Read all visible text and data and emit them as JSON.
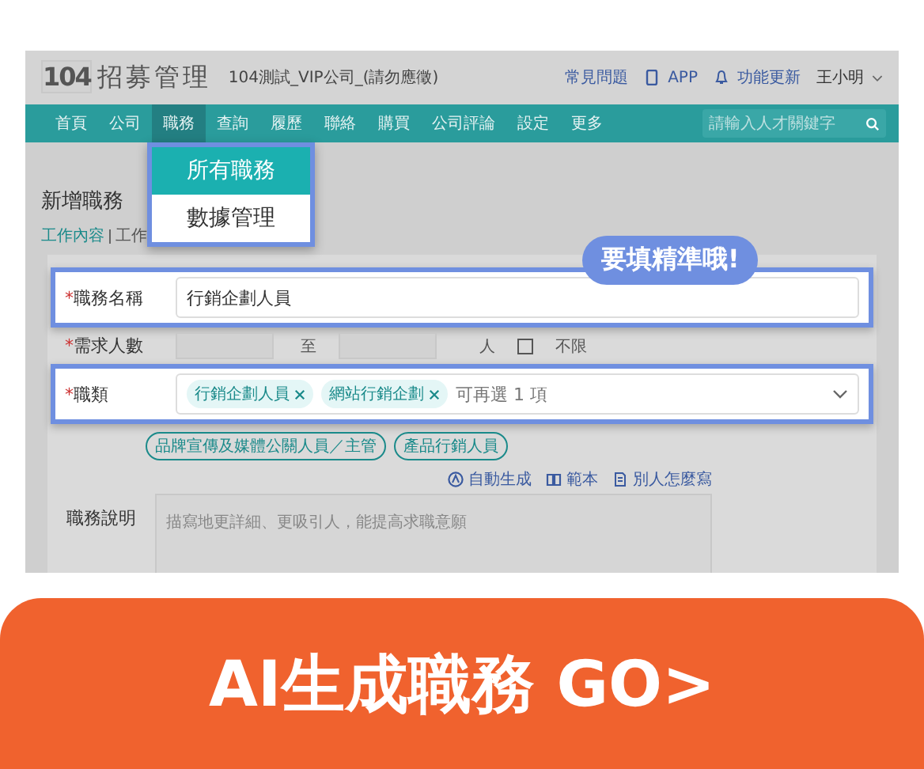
{
  "header": {
    "logo_number": "104",
    "logo_text": "招募管理",
    "company": "104測試_VIP公司_(請勿應徵)",
    "links": [
      {
        "kind": "help",
        "label": "常見問題"
      },
      {
        "kind": "app",
        "label": "APP"
      },
      {
        "kind": "updates",
        "label": "功能更新"
      }
    ],
    "user": "王小明"
  },
  "nav": {
    "items": [
      {
        "label": "首頁",
        "selected": false
      },
      {
        "label": "公司",
        "selected": false
      },
      {
        "label": "職務",
        "selected": true
      },
      {
        "label": "查詢",
        "selected": false
      },
      {
        "label": "履歷",
        "selected": false
      },
      {
        "label": "聯絡",
        "selected": false
      },
      {
        "label": "購買",
        "selected": false
      },
      {
        "label": "公司評論",
        "selected": false
      },
      {
        "label": "設定",
        "selected": false
      },
      {
        "label": "更多",
        "selected": false
      }
    ],
    "search_placeholder": "請輸入人才關鍵字"
  },
  "menu": {
    "items": [
      {
        "label": "所有職務",
        "selected": true
      },
      {
        "label": "數據管理",
        "selected": false
      }
    ]
  },
  "page_title": "新增職務",
  "breadcrumb": [
    {
      "label": "工作內容",
      "selected": true
    },
    {
      "label": "工作",
      "selected": false
    }
  ],
  "tooltip": "要填精準哦!",
  "form": {
    "job_title": {
      "label": "職務名稱",
      "required_mark": "*",
      "value": "行銷企劃人員",
      "highlighted": true
    },
    "headcount": {
      "label": "需求人數",
      "required_mark": "*",
      "to": "至",
      "unit": "人",
      "unlimited": {
        "label": "不限",
        "checked": false
      }
    },
    "category": {
      "label": "職類",
      "required_mark": "*",
      "tags": [
        "行銷企劃人員",
        "網站行銷企劃"
      ],
      "hint": "可再選 1 項",
      "highlighted": true
    },
    "suggestions": [
      "品牌宣傳及媒體公關人員／主管",
      "產品行銷人員"
    ],
    "tools": [
      {
        "kind": "ai",
        "label": "自動生成"
      },
      {
        "kind": "book",
        "label": "範本"
      },
      {
        "kind": "doc",
        "label": "別人怎麼寫"
      }
    ],
    "description": {
      "label": "職務說明",
      "placeholder": "描寫地更詳細、更吸引人，能提高求職意願"
    }
  },
  "banner": "AI生成職務 GO>"
}
